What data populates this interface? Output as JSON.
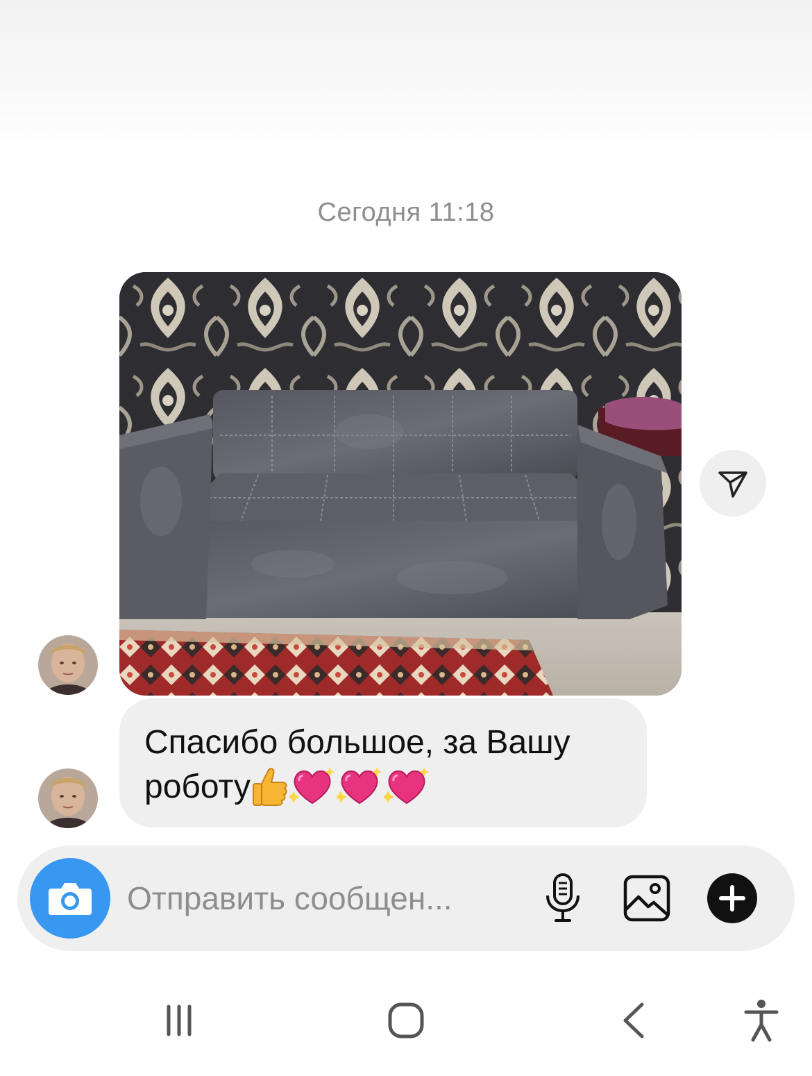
{
  "chat": {
    "timestamp": "Сегодня 11:18",
    "messages": [
      {
        "type": "photo",
        "icon": "sofa-photo"
      },
      {
        "type": "text",
        "text": "Спасибо большое, за Вашу роботу",
        "emojis": [
          "thumbs-up-emoji",
          "sparkling-heart-emoji",
          "sparkling-heart-emoji",
          "sparkling-heart-emoji"
        ]
      }
    ],
    "share_icon": "paper-plane-icon"
  },
  "composer": {
    "placeholder": "Отправить сообщен...",
    "camera_icon": "camera-icon",
    "mic_icon": "microphone-icon",
    "gallery_icon": "gallery-icon",
    "plus_icon": "plus-circle-icon",
    "accent": "#3897f0"
  },
  "nav": {
    "items": [
      "recents-icon",
      "home-icon",
      "back-icon",
      "accessibility-icon"
    ]
  }
}
